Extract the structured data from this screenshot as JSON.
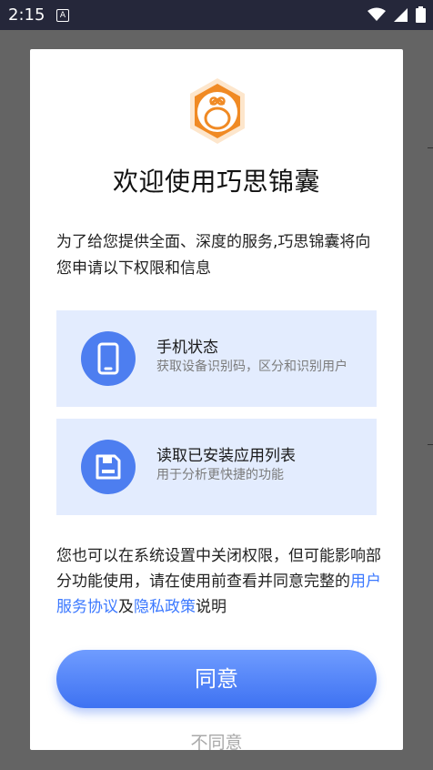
{
  "status_bar": {
    "time": "2:15",
    "app_icon_letter": "A",
    "icons": [
      "wifi-icon",
      "signal-icon",
      "battery-icon"
    ]
  },
  "dialog": {
    "title": "欢迎使用巧思锦囊",
    "intro": "为了给您提供全面、深度的服务,巧思锦囊将向您申请以下权限和信息",
    "permissions": [
      {
        "icon": "phone-icon",
        "title": "手机状态",
        "desc": "获取设备识别码，区分和识别用户"
      },
      {
        "icon": "save-icon",
        "title": "读取已安装应用列表",
        "desc": "用于分析更快捷的功能"
      }
    ],
    "footer": {
      "text_before": "您也可以在系统设置中关闭权限，但可能影响部分功能使用，请在使用前查看并同意完整的",
      "link_service": "用户服务协议",
      "text_and": "及",
      "link_privacy": "隐私政策",
      "text_after": "说明"
    },
    "agree_label": "同意",
    "disagree_label": "不同意"
  },
  "colors": {
    "accent": "#4D7EF0",
    "card_bg": "#E3ECFE",
    "link": "#3B78FF",
    "logo_orange": "#F08A24",
    "status_bar": "#25273A"
  }
}
